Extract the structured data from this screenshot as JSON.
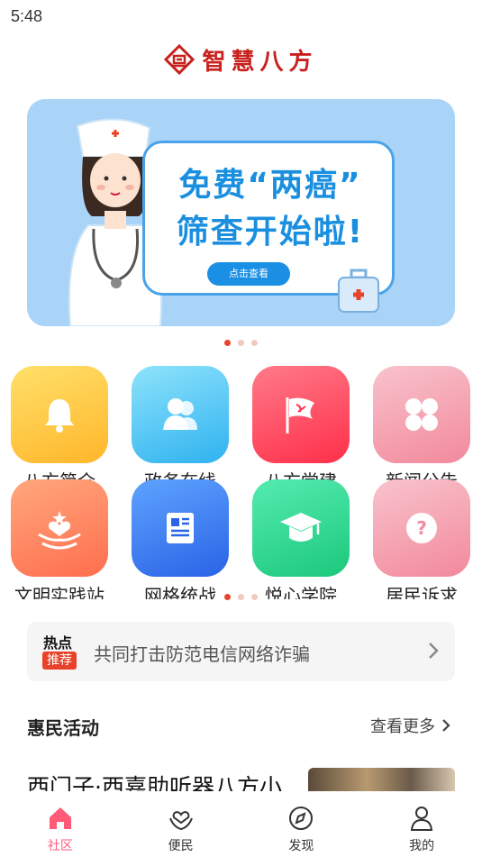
{
  "status": {
    "time": "5:48"
  },
  "brand": {
    "name": "智慧八方",
    "color": "#c8201d"
  },
  "banner": {
    "line1": "免费“两癌”",
    "line2": "筛查开始啦!",
    "button_label": "点击查看",
    "dots_total": 3,
    "dots_active": 0
  },
  "grid": {
    "pages_total": 3,
    "page_active": 0,
    "items": [
      {
        "label": "八方简介",
        "icon": "bell-icon",
        "color": "#ffc83a"
      },
      {
        "label": "政务在线",
        "icon": "people-icon",
        "color": "#49c6f4"
      },
      {
        "label": "八方党建",
        "icon": "party-flag-icon",
        "color": "#ff4a5e"
      },
      {
        "label": "新闻公告",
        "icon": "grid-clover-icon",
        "color": "#f5a3b0"
      },
      {
        "label": "文明实践站",
        "icon": "heart-hands-icon",
        "color": "#ff8a62"
      },
      {
        "label": "网格统战",
        "icon": "newspaper-icon",
        "color": "#3a7ff0"
      },
      {
        "label": "悦心学院",
        "icon": "graduation-cap-icon",
        "color": "#2fd58a"
      },
      {
        "label": "居民诉求",
        "icon": "question-icon",
        "color": "#f5a3b0"
      }
    ]
  },
  "notice": {
    "tag_top": "热点",
    "tag_bottom": "推荐",
    "text": "共同打击防范电信网络诈骗"
  },
  "section": {
    "title": "惠民活动",
    "more": "查看更多"
  },
  "article": {
    "title": "西门子·西嘉助听器八方小"
  },
  "tabbar": {
    "items": [
      {
        "label": "社区",
        "icon": "home-icon",
        "active": true
      },
      {
        "label": "便民",
        "icon": "heart-hand-icon",
        "active": false
      },
      {
        "label": "发现",
        "icon": "compass-icon",
        "active": false
      },
      {
        "label": "我的",
        "icon": "user-icon",
        "active": false
      }
    ],
    "active_color": "#ff5a78"
  }
}
